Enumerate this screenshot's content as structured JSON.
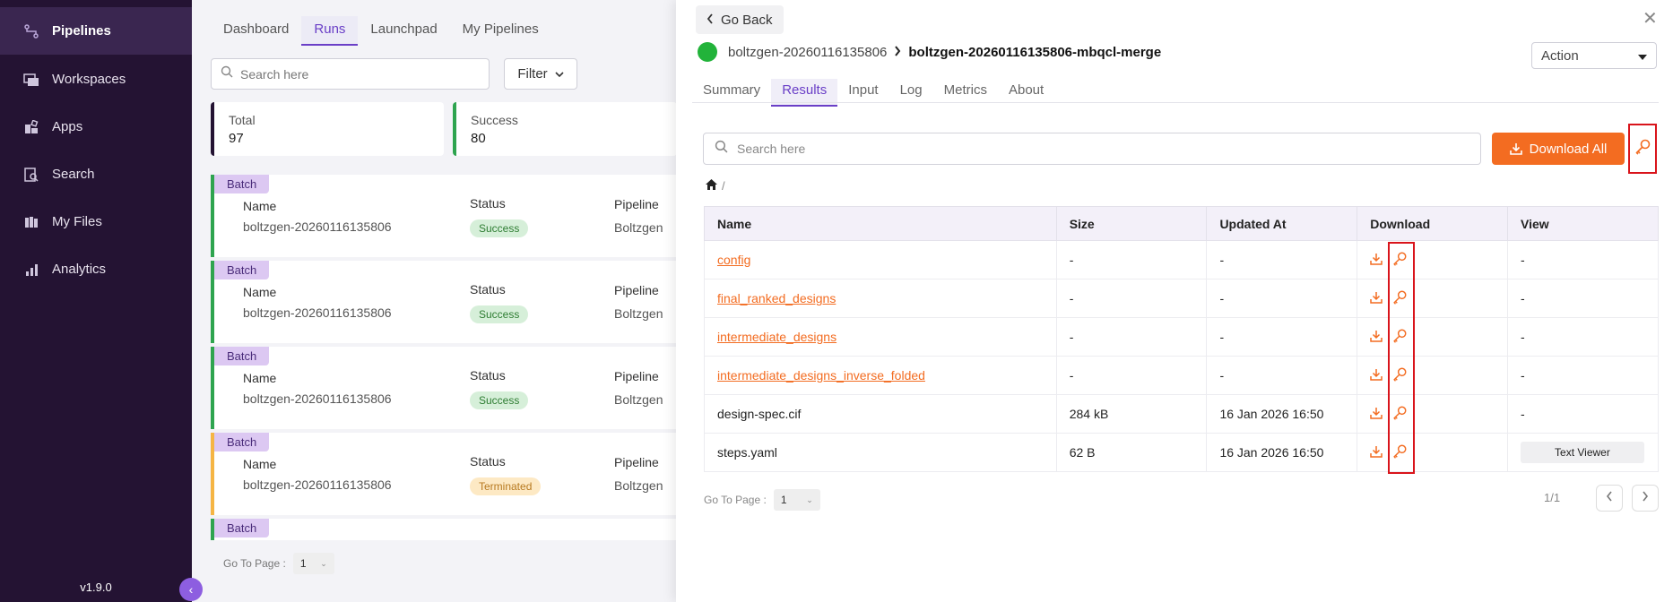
{
  "sidebar": {
    "items": [
      {
        "label": "Pipelines",
        "icon": "pipelines-icon"
      },
      {
        "label": "Workspaces",
        "icon": "workspaces-icon"
      },
      {
        "label": "Apps",
        "icon": "apps-icon"
      },
      {
        "label": "Search",
        "icon": "search-doc-icon"
      },
      {
        "label": "My Files",
        "icon": "files-icon"
      },
      {
        "label": "Analytics",
        "icon": "analytics-icon"
      }
    ],
    "version": "v1.9.0"
  },
  "main": {
    "tabs": [
      "Dashboard",
      "Runs",
      "Launchpad",
      "My Pipelines"
    ],
    "active_tab": "Runs",
    "search_placeholder": "Search here",
    "filter_label": "Filter",
    "stats": [
      {
        "label": "Total",
        "value": "97"
      },
      {
        "label": "Success",
        "value": "80"
      }
    ],
    "runs": [
      {
        "badge": "Batch",
        "name_label": "Name",
        "name": "boltzgen-20260116135806",
        "status_label": "Status",
        "status": "Success",
        "pipeline_label": "Pipeline",
        "pipeline": "Boltzgen"
      },
      {
        "badge": "Batch",
        "name_label": "Name",
        "name": "boltzgen-20260116135806",
        "status_label": "Status",
        "status": "Success",
        "pipeline_label": "Pipeline",
        "pipeline": "Boltzgen"
      },
      {
        "badge": "Batch",
        "name_label": "Name",
        "name": "boltzgen-20260116135806",
        "status_label": "Status",
        "status": "Success",
        "pipeline_label": "Pipeline",
        "pipeline": "Boltzgen"
      },
      {
        "badge": "Batch",
        "name_label": "Name",
        "name": "boltzgen-20260116135806",
        "status_label": "Status",
        "status": "Terminated",
        "pipeline_label": "Pipeline",
        "pipeline": "Boltzgen"
      }
    ],
    "last_badge": "Batch",
    "goto_label": "Go To Page :",
    "goto_value": "1"
  },
  "panel": {
    "go_back": "Go Back",
    "breadcrumb_parent": "boltzgen-20260116135806",
    "breadcrumb_current": "boltzgen-20260116135806-mbqcl-merge",
    "action_label": "Action",
    "tabs": [
      "Summary",
      "Results",
      "Input",
      "Log",
      "Metrics",
      "About"
    ],
    "active_tab": "Results",
    "search_placeholder": "Search here",
    "download_all": "Download All",
    "path_sep": "/",
    "table": {
      "headers": [
        "Name",
        "Size",
        "Updated At",
        "Download",
        "View"
      ],
      "rows": [
        {
          "name": "config",
          "link": true,
          "size": "-",
          "updated": "-",
          "view": "-"
        },
        {
          "name": "final_ranked_designs",
          "link": true,
          "size": "-",
          "updated": "-",
          "view": "-"
        },
        {
          "name": "intermediate_designs",
          "link": true,
          "size": "-",
          "updated": "-",
          "view": "-"
        },
        {
          "name": "intermediate_designs_inverse_folded",
          "link": true,
          "size": "-",
          "updated": "-",
          "view": "-"
        },
        {
          "name": "design-spec.cif",
          "link": false,
          "size": "284 kB",
          "updated": "16 Jan 2026 16:50",
          "view": "-"
        },
        {
          "name": "steps.yaml",
          "link": false,
          "size": "62 B",
          "updated": "16 Jan 2026 16:50",
          "view": "Text Viewer"
        }
      ]
    },
    "goto_label": "Go To Page :",
    "goto_value": "1",
    "page_count": "1/1"
  },
  "colors": {
    "sidebar_bg": "#241333",
    "accent": "#6a3fc7",
    "orange": "#f36c21",
    "success": "#22b33a",
    "highlight_red": "#d9141b"
  }
}
